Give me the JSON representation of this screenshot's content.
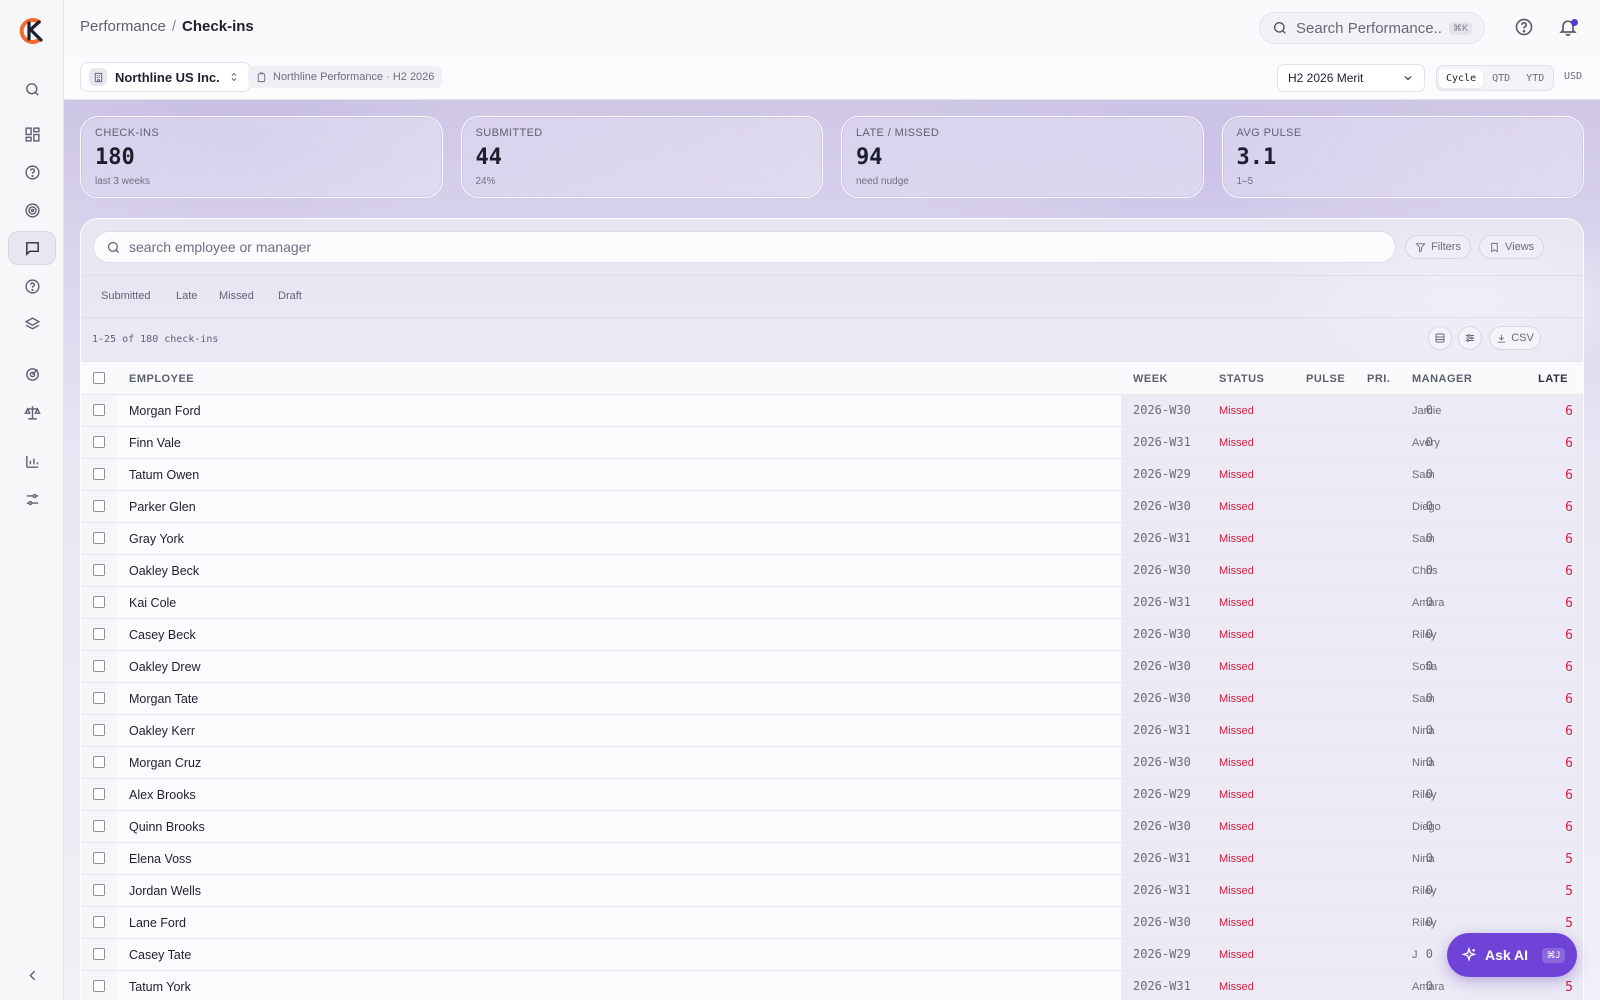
{
  "breadcrumb": {
    "parent": "Performance",
    "separator": "/",
    "current": "Check-ins"
  },
  "top_search": {
    "placeholder": "Search Performance...",
    "shortcut": "⌘K"
  },
  "subbar": {
    "company": "Northline US Inc.",
    "cycle_chip": "Northline Performance · H2 2026",
    "plan_select": "H2 2026 Merit",
    "period_tabs": [
      "Cycle",
      "QTD",
      "YTD"
    ],
    "period_selected": "Cycle",
    "currency": "USD"
  },
  "kpis": [
    {
      "label": "CHECK-INS",
      "value": "180",
      "sub": "last 3 weeks"
    },
    {
      "label": "SUBMITTED",
      "value": "44",
      "sub": "24%"
    },
    {
      "label": "LATE / MISSED",
      "value": "94",
      "sub": "need nudge"
    },
    {
      "label": "AVG PULSE",
      "value": "3.1",
      "sub": "1–5"
    }
  ],
  "panel": {
    "search_placeholder": "search employee or manager",
    "filters_label": "Filters",
    "views_label": "Views",
    "status_chips": [
      "Submitted",
      "Late",
      "Missed",
      "Draft"
    ],
    "count_text": "1-25 of 180 check-ins",
    "csv_label": "CSV"
  },
  "table": {
    "headers": {
      "employee": "EMPLOYEE",
      "week": "WEEK",
      "status": "STATUS",
      "pulse": "PULSE",
      "pri": "PRI.",
      "manager": "MANAGER",
      "late": "LATE"
    },
    "rows": [
      {
        "name": "Morgan Ford",
        "week": "2026-W30",
        "status": "Missed",
        "pulse": "",
        "pri": "0",
        "manager": "Jamie",
        "late": "6"
      },
      {
        "name": "Finn Vale",
        "week": "2026-W31",
        "status": "Missed",
        "pulse": "",
        "pri": "0",
        "manager": "Avery",
        "late": "6"
      },
      {
        "name": "Tatum Owen",
        "week": "2026-W29",
        "status": "Missed",
        "pulse": "",
        "pri": "0",
        "manager": "Sam",
        "late": "6"
      },
      {
        "name": "Parker Glen",
        "week": "2026-W30",
        "status": "Missed",
        "pulse": "",
        "pri": "0",
        "manager": "Diego",
        "late": "6"
      },
      {
        "name": "Gray York",
        "week": "2026-W31",
        "status": "Missed",
        "pulse": "",
        "pri": "0",
        "manager": "Sam",
        "late": "6"
      },
      {
        "name": "Oakley Beck",
        "week": "2026-W30",
        "status": "Missed",
        "pulse": "",
        "pri": "0",
        "manager": "Chris",
        "late": "6"
      },
      {
        "name": "Kai Cole",
        "week": "2026-W31",
        "status": "Missed",
        "pulse": "",
        "pri": "0",
        "manager": "Amara",
        "late": "6"
      },
      {
        "name": "Casey Beck",
        "week": "2026-W30",
        "status": "Missed",
        "pulse": "",
        "pri": "0",
        "manager": "Riley",
        "late": "6"
      },
      {
        "name": "Oakley Drew",
        "week": "2026-W30",
        "status": "Missed",
        "pulse": "",
        "pri": "0",
        "manager": "Sofia",
        "late": "6"
      },
      {
        "name": "Morgan Tate",
        "week": "2026-W30",
        "status": "Missed",
        "pulse": "",
        "pri": "0",
        "manager": "Sam",
        "late": "6"
      },
      {
        "name": "Oakley Kerr",
        "week": "2026-W31",
        "status": "Missed",
        "pulse": "",
        "pri": "0",
        "manager": "Nina",
        "late": "6"
      },
      {
        "name": "Morgan Cruz",
        "week": "2026-W30",
        "status": "Missed",
        "pulse": "",
        "pri": "0",
        "manager": "Nina",
        "late": "6"
      },
      {
        "name": "Alex Brooks",
        "week": "2026-W29",
        "status": "Missed",
        "pulse": "",
        "pri": "0",
        "manager": "Riley",
        "late": "6"
      },
      {
        "name": "Quinn Brooks",
        "week": "2026-W30",
        "status": "Missed",
        "pulse": "",
        "pri": "0",
        "manager": "Diego",
        "late": "6"
      },
      {
        "name": "Elena Voss",
        "week": "2026-W31",
        "status": "Missed",
        "pulse": "",
        "pri": "0",
        "manager": "Nina",
        "late": "5"
      },
      {
        "name": "Jordan Wells",
        "week": "2026-W31",
        "status": "Missed",
        "pulse": "",
        "pri": "0",
        "manager": "Riley",
        "late": "5"
      },
      {
        "name": "Lane Ford",
        "week": "2026-W30",
        "status": "Missed",
        "pulse": "",
        "pri": "0",
        "manager": "Riley",
        "late": "5"
      },
      {
        "name": "Casey Tate",
        "week": "2026-W29",
        "status": "Missed",
        "pulse": "",
        "pri": "0",
        "manager": "J",
        "late": "5"
      },
      {
        "name": "Tatum York",
        "week": "2026-W31",
        "status": "Missed",
        "pulse": "",
        "pri": "0",
        "manager": "Amara",
        "late": "5"
      }
    ]
  },
  "ask_ai": {
    "label": "Ask AI",
    "shortcut": "⌘J"
  },
  "colors": {
    "accent": "#6f42d8",
    "missed": "#d11f3d",
    "brand_orange": "#f26a2e"
  }
}
